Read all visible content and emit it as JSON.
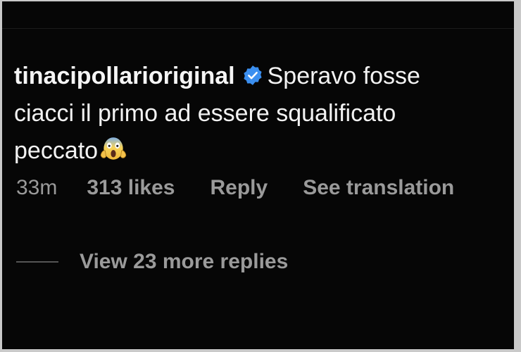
{
  "comment": {
    "username": "tinacipollarioriginal",
    "verified_icon": "verified-badge-icon",
    "text_line1": "Speravo fosse",
    "text_line2": "ciacci il primo ad essere squalificato",
    "text_line3": "peccato",
    "emoji": "face-screaming-in-fear-icon"
  },
  "meta": {
    "time": "33m",
    "likes": "313 likes",
    "reply_label": "Reply",
    "translation_label": "See translation"
  },
  "replies": {
    "label": "View 23 more replies"
  },
  "colors": {
    "background": "#060606",
    "text_primary": "#f2f2f2",
    "text_secondary": "#9a9a9a",
    "verified_blue": "#3b8ff0"
  }
}
